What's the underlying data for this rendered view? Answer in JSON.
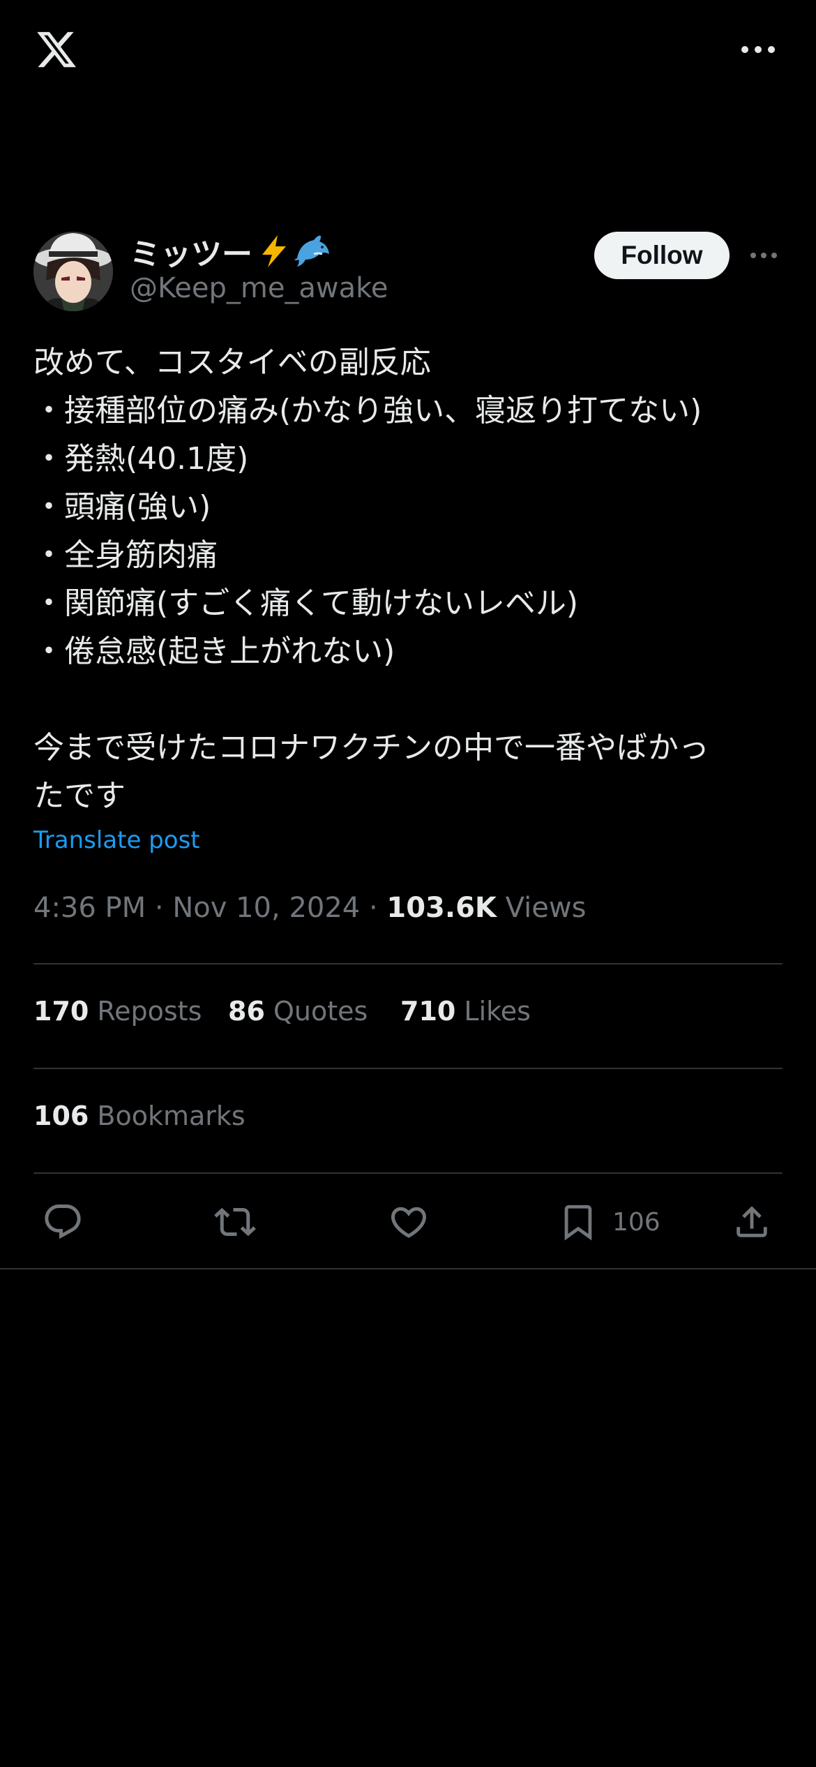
{
  "header": {
    "logo_icon": "x-logo-icon",
    "more_icon": "more-horizontal-icon"
  },
  "author": {
    "display_name": "ミッツー",
    "name_emojis": [
      "high-voltage-emoji",
      "dolphin-emoji"
    ],
    "handle": "@Keep_me_awake",
    "follow_label": "Follow"
  },
  "tweet": {
    "text": "改めて、コスタイベの副反応\n・接種部位の痛み(かなり強い、寝返り打てない)\n・発熱(40.1度)\n・頭痛(強い)\n・全身筋肉痛\n・関節痛(すごく痛くて動けないレベル)\n・倦怠感(起き上がれない)\n\n今まで受けたコロナワクチンの中で一番やばかっ\nたです",
    "translate_label": "Translate post",
    "time": "4:36 PM",
    "date": "Nov 10, 2024",
    "views_count": "103.6K",
    "views_label": "Views"
  },
  "stats": {
    "reposts_count": "170",
    "reposts_label": "Reposts",
    "quotes_count": "86",
    "quotes_label": "Quotes",
    "likes_count": "710",
    "likes_label": "Likes",
    "bookmarks_count": "106",
    "bookmarks_label": "Bookmarks"
  },
  "actions": {
    "reply_icon": "reply-icon",
    "repost_icon": "repost-icon",
    "like_icon": "heart-icon",
    "bookmark_icon": "bookmark-icon",
    "bookmark_count": "106",
    "share_icon": "share-icon"
  },
  "colors": {
    "background": "#000000",
    "text_primary": "#e7e9ea",
    "text_secondary": "#71767b",
    "accent": "#1d9bf0",
    "divider": "#2f3336",
    "follow_bg": "#eff3f4"
  }
}
